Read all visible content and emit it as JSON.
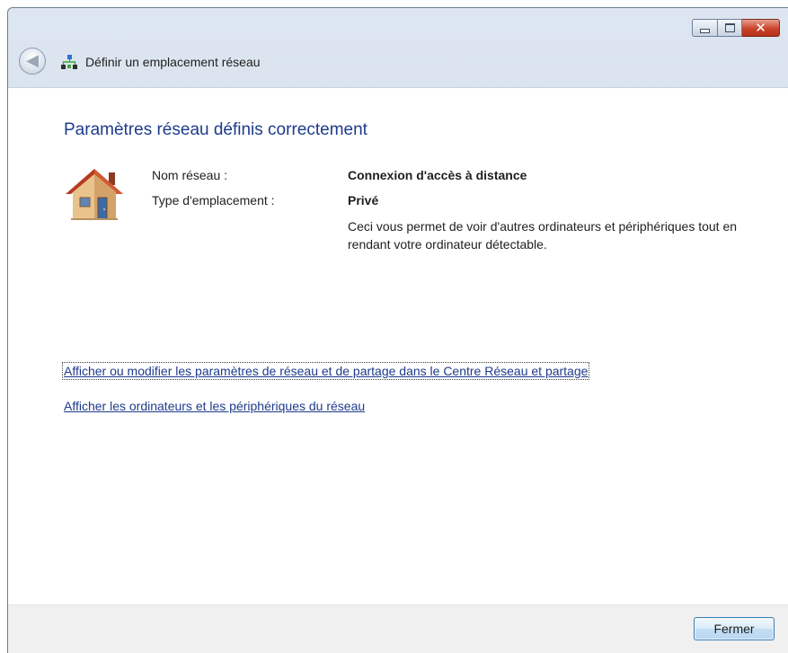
{
  "window": {
    "title": "Définir un emplacement réseau",
    "caption": {
      "close_glyph": "✕",
      "back_glyph": "◀"
    }
  },
  "content": {
    "heading": "Paramètres réseau définis correctement",
    "network_name_label": "Nom réseau :",
    "network_name_value": "Connexion d'accès à distance",
    "location_type_label": "Type d'emplacement :",
    "location_type_value": "Privé",
    "location_description": "Ceci vous permet de voir d'autres ordinateurs et périphériques tout en rendant votre ordinateur détectable.",
    "links": [
      "Afficher ou modifier les paramètres de réseau et de partage dans le Centre Réseau et partage",
      "Afficher les ordinateurs et les périphériques du réseau"
    ]
  },
  "footer": {
    "close_button_label": "Fermer"
  },
  "icons": [
    "back-arrow-icon",
    "network-icon",
    "house-icon",
    "minimize-icon",
    "maximize-icon",
    "close-icon"
  ],
  "colors": {
    "heading": "#1e3b8c",
    "link": "#1e3b8c",
    "close_button": "#c8442a"
  }
}
